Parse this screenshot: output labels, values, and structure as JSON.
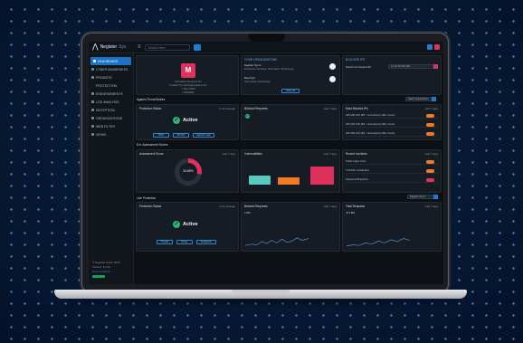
{
  "app": {
    "brand": "Negister",
    "brand_sub": "Sys",
    "search_placeholder": "Search here"
  },
  "sidebar": {
    "items": [
      {
        "label": "DASHBOARD",
        "active": true
      },
      {
        "label": "CYBER AWARENESS"
      },
      {
        "label": "PROMOTE"
      },
      {
        "label": "PROTECTION"
      },
      {
        "label": "ENDORSEMENTS"
      },
      {
        "label": "LOG ANALYSIS"
      },
      {
        "label": "DECEPTION"
      },
      {
        "label": "ORGANIZATIONS"
      },
      {
        "label": "WEB FILTER"
      },
      {
        "label": "VIEWS"
      }
    ],
    "footer": {
      "copyright": "© Negister Cyber 2023",
      "version": "Version: 3.0.15",
      "link": "Documentation"
    }
  },
  "profile": {
    "initial": "M",
    "line1": "Simulation Services Inc",
    "line2": "Created by: admin@negister.com",
    "line3": "7 Sept 2023",
    "line4": "LINKEDIN"
  },
  "organization": {
    "title": "YOUR ORGANIZATIONS",
    "org1_name": "Negister Sys.A",
    "org1_sub": "Enterprise Services, Information Technology",
    "org2_name": "Brest Sys",
    "org2_sub": "Information Technology",
    "button": "Show all"
  },
  "blocked": {
    "title": "BLOCKED IPs",
    "label": "Search for blocked IPs",
    "input": "ex: 10.10.100.100"
  },
  "sections": {
    "threat": "Against Threat Bodies",
    "assessment": "Ext. Assessment Scores",
    "incident": "Line Protection"
  },
  "protection1": {
    "title": "Protection Status",
    "link": "3 min average",
    "status": "Active",
    "btn1": "DNS",
    "btn2": "WI-Opt",
    "btn3": "Agentic Login"
  },
  "blocked_requests": {
    "title": "Blocked Requests",
    "link": "Last 7 days"
  },
  "most_blocked": {
    "title": "Most Blocked IPs",
    "link": "Last 7 days",
    "filter": "Select Organization",
    "rows": [
      "185.230.125.183 - Unresolved (100+ hours)",
      "185.230.125.183 - Unresolved (100+ hours)",
      "185.230.125.183 - Unresolved (100+ hours)"
    ]
  },
  "assessment": {
    "title": "Assessment Score",
    "link": "Last 7 days",
    "value": "34.85%"
  },
  "vulnerabilities": {
    "title": "Vulnerabilities",
    "link": "Last 7 days"
  },
  "recent": {
    "title": "Recent Incidents",
    "link": "Last 7 days",
    "rows": [
      "Public Open Ports",
      "TLS/SSL Certificates",
      "Password Breaches"
    ]
  },
  "protection2": {
    "title": "Protection Status",
    "link": "3 min average",
    "status": "Active",
    "btn1": "Tunnel",
    "btn2": "Proxy",
    "btn3": "Endpoints"
  },
  "blocked2": {
    "title": "Blocked Requests",
    "link": "Last 7 days",
    "count": "1.8M"
  },
  "total": {
    "title": "Total Requests",
    "link": "Last 7 days",
    "count": "473.8M"
  },
  "filter2": "Negister Sys.A",
  "colors": {
    "accent": "#1e7ad3",
    "brand_pink": "#e0305c",
    "teal": "#58cbc0",
    "orange": "#f07a26",
    "active_green": "#2bb673"
  }
}
